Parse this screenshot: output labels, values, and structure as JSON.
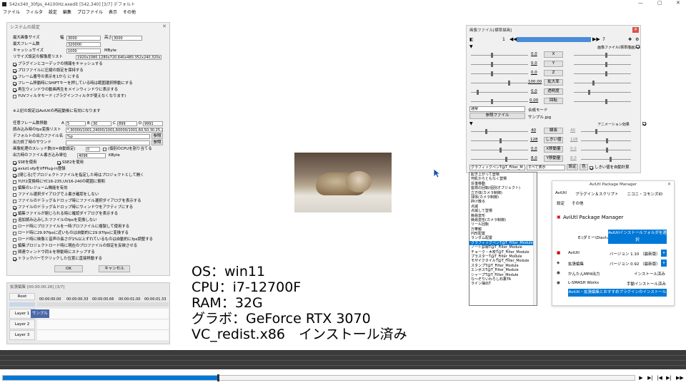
{
  "titlebar": {
    "title": "542x340_30fps_44100Hz.exedit [542,340] [3/7] デフォルト"
  },
  "menu": [
    "ファイル",
    "フィルタ",
    "設定",
    "編集",
    "プロファイル",
    "表示",
    "その他"
  ],
  "sys": {
    "title": "システムの設定",
    "max_size_label": "最大画像サイズ",
    "w_label": "幅",
    "w": "3000",
    "h_label": "高さ",
    "h": "3000",
    "max_frames_label": "最大フレーム数",
    "max_frames": "320000",
    "cache_label": "キャッシュサイズ",
    "cache": "1000",
    "cache_unit": "MByte",
    "resize_label": "リサイズ設定の解像度リスト",
    "resize": "1920x1080,1280x720,640x480,352x240,320x240",
    "checks1": [
      {
        "t": "プラグインとコーデックの情報をキャッシュする",
        "on": true
      },
      {
        "t": "プロファイルに圧縮の設定を保持する",
        "on": true
      },
      {
        "t": "フレーム番号の表示を1から にする",
        "on": true
      },
      {
        "t": "フレーム移動時にSHIFTキーを押している時は範囲選択移動にする",
        "on": true
      },
      {
        "t": "再生ウィンドウの動画再生をメインウィンドウに表示する",
        "on": true
      },
      {
        "t": "YUVフィルタモード (プラグインフィルタが使えなくなります)",
        "on": false
      }
    ],
    "note": "※上記の設定はAviUtlの再起動後に有効になります",
    "jump_label": "任意フレーム数移動",
    "jump_a": "5",
    "jump_b": "30",
    "jump_c": "899",
    "jump_d": "9991",
    "fps_label": "読み込み時のfps変換リスト",
    "fps": "*,30000/1001,24000/1001,60000/1001,60,50,30,25,24,20,15,12,10,8,6,5,4,3,2,1",
    "outname_label": "デフォルトの出力ファイル名",
    "outname": "%p",
    "ref1": "参照",
    "sound_label": "出力終了時のサウンド",
    "ref2": "参照",
    "threads_label": "画像処理のスレッド数(0=自動設定)",
    "threads": "0",
    "cpu_label": "(個別のCPUを割り当てる",
    "writeunit_label": "出力時のファイル書き込み単位",
    "writeunit": "4096",
    "writeunit_unit": "KByte",
    "sse": "SSEを使用",
    "sse2": "SSE2を使用",
    "checks2": [
      {
        "t": "aviutl.vfpをVFPlug-in登録",
        "on": true
      },
      {
        "t": "[閉じる]でプロジェクトファイルを指定した時はプロジェクトとして開く",
        "on": true
      },
      {
        "t": "YUY2変換時にYC16-235,UV16-240の範囲に飽和",
        "on": false
      },
      {
        "t": "編集のレジューム機能を有効",
        "on": false
      },
      {
        "t": "ファイル選択ダイアログで上書き確認をしない",
        "on": false
      },
      {
        "t": "ファイルのドラッグ＆ドロップ時にファイル選択ダイアログを表示する",
        "on": false
      },
      {
        "t": "ファイルのドラッグ＆ドロップ時にウィンドウをアクティブにする",
        "on": true
      },
      {
        "t": "編集ファイルが閉じられる時に確認ダイアログを表示する",
        "on": true
      },
      {
        "t": "追加読み込みしたファイルのfpsを変換しない",
        "on": false
      },
      {
        "t": "ロード時にプロファイルを一時プロファイルに複製して使用する",
        "on": false
      },
      {
        "t": "ロード時に29.97fpsに近いものは自動的に29.97fpsに変換する",
        "on": false
      },
      {
        "t": "ロード時に映像と音声の長さが1%以上ずれているものは自動的にfps調整する",
        "on": false
      },
      {
        "t": "編集プロジェクトロード時に現在のプロファイルの設定を反映させる",
        "on": false
      },
      {
        "t": "関連ウィンドウ同士を移動時にスナップする",
        "on": false
      },
      {
        "t": "トラックバーでクリックした位置に直接移動する",
        "on": true
      }
    ],
    "ok": "OK",
    "cancel": "キャンセル"
  },
  "ext": {
    "title": "拡張編集 [00:00:00.26] [3/7]",
    "root": "Root",
    "ticks": [
      "00:00:00.00",
      "00:00:00.33",
      "00:00:00.66",
      "00:00:01.00",
      "00:00:01.33"
    ],
    "layers": [
      "Layer 1",
      "Layer 2",
      "Layer 3"
    ],
    "clip": "サンプル"
  },
  "specs": [
    "OS：win11",
    "CPU：i7-12700F",
    "RAM：32G",
    "グラボ：GeForce RTX 3070",
    "VC_redist.x86　インストール済み"
  ],
  "img": {
    "title": "画像ファイル[標準描画]",
    "frame_start": "1",
    "frame_end": "7",
    "props": [
      {
        "v": "0.0",
        "b": "X"
      },
      {
        "v": "0.0",
        "b": "Y"
      },
      {
        "v": "0.0",
        "b": "Z"
      },
      {
        "v": "100.00",
        "b": "拡大率"
      },
      {
        "v": "0.0",
        "b": "透明度"
      },
      {
        "v": "0.00",
        "b": "回転"
      }
    ],
    "blend_label": "合成モード",
    "blend": "通常",
    "ref": "参照ファイル",
    "file": "サンプル.jpg",
    "anim_label": "アニメーション効果",
    "filter_label": "画像ファイル(標準描画)",
    "fx": [
      {
        "v": "40",
        "b": "線長",
        "r": "40"
      },
      {
        "v": "128",
        "b": "しきい値",
        "r": "128"
      },
      {
        "v": "0.0",
        "b": "X移動量",
        "r": "0.0"
      },
      {
        "v": "8.0",
        "b": "Y移動量",
        "r": "8.0"
      }
    ],
    "combo": "グラフィックペンT@T_Filter_M",
    "combo2": "すべて表示",
    "set": "設定",
    "pick": "色",
    "auto": "しきい値を自動計算"
  },
  "dlist": [
    "起き上がって登場",
    "何処からともなく登場",
    "反復移動",
    "座標の回転(個別オブジェクト)",
    "立方体(カメラ制御)",
    "球体(カメラ制御)",
    "砕け散る",
    "点滅",
    "点滅して登場",
    "簡易変形",
    "簡易変形(カメラ制御)",
    "リール回転",
    "万華鏡",
    "円形配置",
    "ランダム配置",
    "グラフィックペンT@T_Filter_Module",
    "ノート罫線T@T_Filter_Module",
    "チョーク・木炭T@T_Filter_Module",
    "プラスターT@T_Filter_Module",
    "モザイクタイルT@T_Filter_Module",
    "スタンプT@T_Filter_Module",
    "エンボスT@T_Filter_Module",
    "シャープT@T_Filter_Module",
    "な～ぞりいわらし石裏TA",
    "ライン抽出T"
  ],
  "pkg": {
    "title": "AviUtl Package Manager",
    "menu": [
      "AviUtl",
      "プラグイン＆スクリプト",
      "ニコニ・コモンズID"
    ],
    "tabs": [
      "設定",
      "その他"
    ],
    "heading": "AviUtl Package Manager",
    "path": "E:\\ダミー\\Diavlutl2024",
    "open": "AviUtlインストールフォルダを選択",
    "rows": [
      {
        "n": "AviUtl",
        "v": "バージョン 1.10 （最新版）"
      },
      {
        "n": "拡張編集",
        "v": "バージョン 0.92 （最新版）"
      },
      {
        "n": "かんたんMP4出力",
        "v": "インストール済み"
      },
      {
        "n": "L-SMASH Works",
        "v": "手動インストール済み"
      }
    ],
    "install": "AviUtl・拡張編集とおすすめプラグインのインストール"
  },
  "seek": {
    "progress": 0.34
  },
  "colors": {
    "accent": "#0078d7",
    "clip": "#4b68a8"
  }
}
